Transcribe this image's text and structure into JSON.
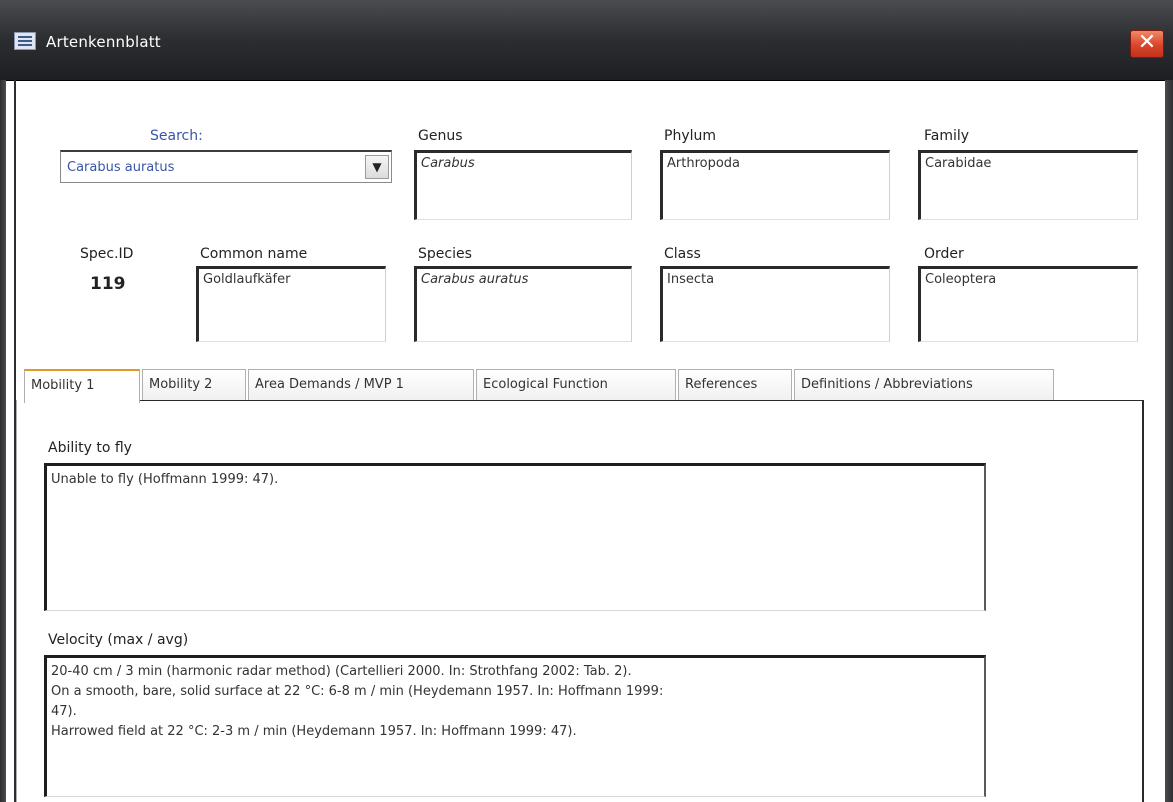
{
  "window": {
    "title": "Artenkennblatt",
    "close_glyph": "✕"
  },
  "search": {
    "label": "Search:",
    "value": "Carabus auratus",
    "dropdown_glyph": "▼"
  },
  "taxonomy": {
    "genus_label": "Genus",
    "genus_value": "Carabus",
    "phylum_label": "Phylum",
    "phylum_value": "Arthropoda",
    "family_label": "Family",
    "family_value": "Carabidae",
    "species_label": "Species",
    "species_value": "Carabus auratus",
    "class_label": "Class",
    "class_value": "Insecta",
    "order_label": "Order",
    "order_value": "Coleoptera"
  },
  "record": {
    "spec_id_label": "Spec.ID",
    "spec_id_value": "119",
    "common_name_label": "Common name",
    "common_name_value": "Goldlaufkäfer"
  },
  "tabs": [
    {
      "label": "Mobility 1"
    },
    {
      "label": "Mobility 2"
    },
    {
      "label": "Area Demands / MVP 1"
    },
    {
      "label": "Ecological Function"
    },
    {
      "label": "References"
    },
    {
      "label": "Definitions / Abbreviations"
    }
  ],
  "mobility": {
    "flight_label": "Ability to fly",
    "flight_value": "Unable to fly (Hoffmann 1999: 47).",
    "velocity_label": "Velocity (max / avg)",
    "velocity_lines": [
      "20-40 cm / 3 min (harmonic radar method) (Cartellieri 2000. In: Strothfang 2002: Tab. 2).",
      "On a smooth, bare, solid surface at 22 °C: 6-8 m / min (Heydemann 1957. In: Hoffmann 1999:",
      "47).",
      "Harrowed field at 22 °C: 2-3 m / min (Heydemann 1957. In: Hoffmann 1999: 47)."
    ]
  },
  "colors": {
    "titlebar": "#2c2d30",
    "close_button": "#d9452a",
    "link_blue": "#3a55a8",
    "active_tab_accent": "#e09a2a"
  },
  "icons": {
    "window_icon": "form-icon",
    "close": "close-icon",
    "dropdown": "chevron-down-icon"
  }
}
